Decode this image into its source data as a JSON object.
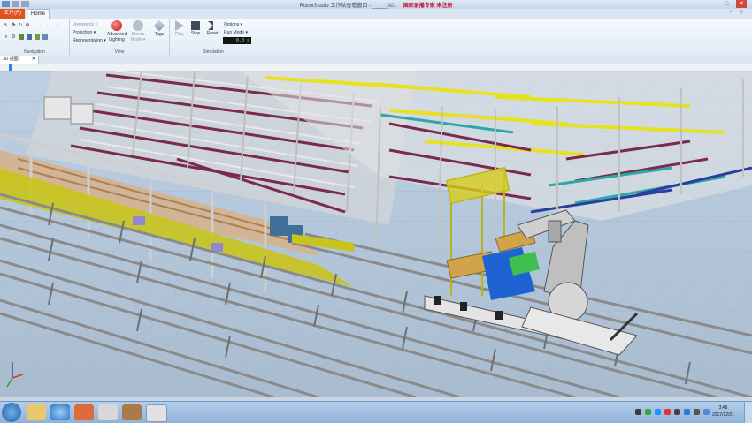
{
  "window": {
    "title": "RobotStudio 工作站查看窗口 - _____A01",
    "title_red": "国家录播专家  未注册",
    "minimize": "–",
    "maximize": "□",
    "close": "✕"
  },
  "tabs": {
    "file": "文件(F)",
    "home": "Home"
  },
  "ribbon_controls": {
    "minimize": "^",
    "help": "?"
  },
  "ribbon": {
    "navigation": {
      "label": "Navigation"
    },
    "view": {
      "label": "View",
      "viewpoints": "Viewpoints ▾",
      "projection": "Projection ▾",
      "representation": "Representation ▾",
      "advanced_lighting": "Advanced Lighting",
      "stereo_mode": "Stereo Mode ▾",
      "tags": "Tags"
    },
    "simulation": {
      "label": "Simulation",
      "play": "Play",
      "stop": "Stop",
      "reset": "Reset",
      "options": "Options ▾",
      "run_mode": "Run Mode ▾",
      "time": "0.0 s"
    }
  },
  "document_tab": {
    "label": "3D 视图",
    "close": "✕"
  },
  "timeline": {
    "position": 0.012
  },
  "taskbar": {
    "clock_time": "3:49",
    "clock_date": "2017/12/21"
  },
  "colors": {
    "file_tab": "#e0511e",
    "rail": "#8a8a8a",
    "yellow_bins": "#e6e21f",
    "magenta_racks": "#7a2a4a",
    "conveyor_yellow": "#c8c41c",
    "frame": "#cfcfcf"
  }
}
